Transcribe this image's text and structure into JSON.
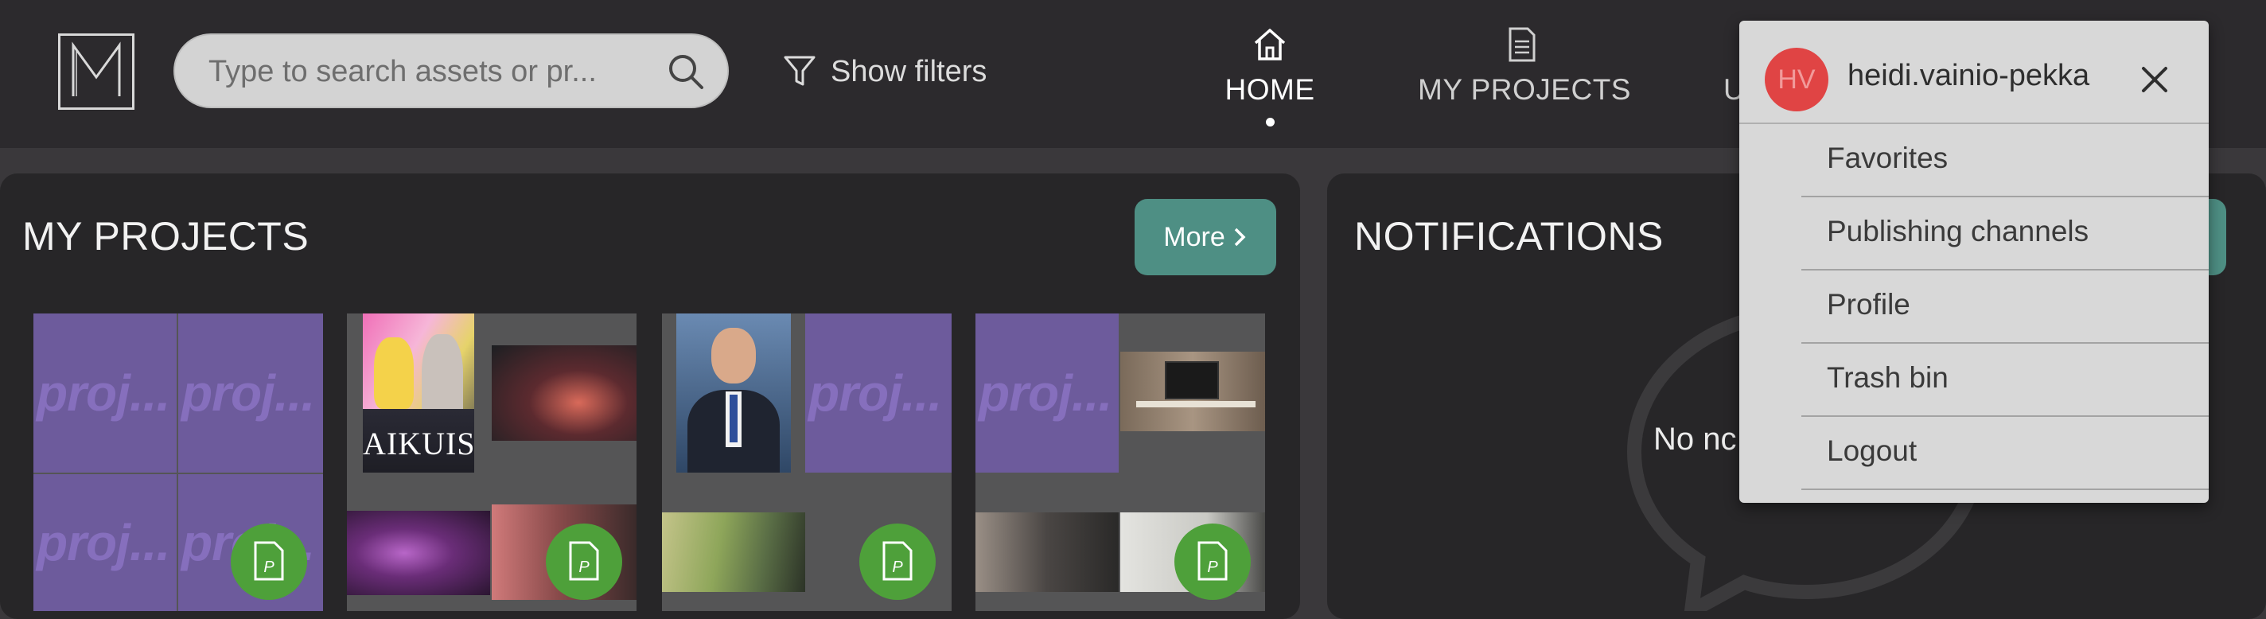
{
  "header": {
    "search_placeholder": "Type to search assets or pr...",
    "show_filters_label": "Show filters",
    "nav": [
      {
        "label": "HOME",
        "icon": "home-icon",
        "active": true
      },
      {
        "label": "MY PROJECTS",
        "icon": "document-icon",
        "active": false
      },
      {
        "label": "U",
        "icon": "",
        "active": false
      }
    ]
  },
  "my_projects": {
    "title": "MY PROJECTS",
    "more_label": "More",
    "placeholder_text": "proj...",
    "image_caption": "AIKUISET",
    "badge_letter": "P"
  },
  "notifications": {
    "title": "NOTIFICATIONS",
    "empty_text": "No nc"
  },
  "user_menu": {
    "initials": "HV",
    "username": "heidi.vainio-pekka",
    "items": [
      "Favorites",
      "Publishing channels",
      "Profile",
      "Trash bin",
      "Logout"
    ]
  },
  "colors": {
    "accent_teal": "#4e8f84",
    "badge_green": "#4ea03a",
    "avatar_red": "#e04444",
    "placeholder_purple": "#6d5b9c"
  }
}
